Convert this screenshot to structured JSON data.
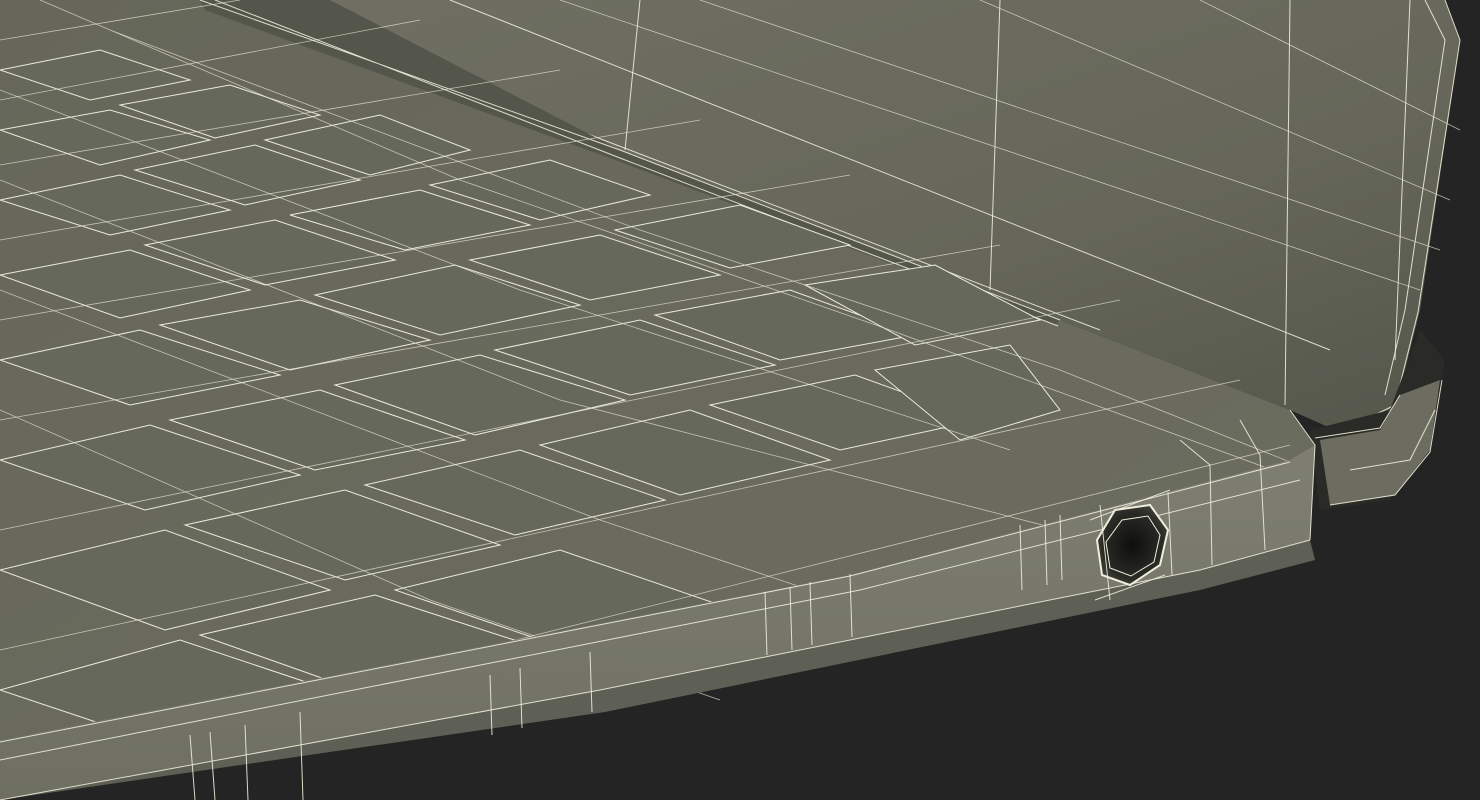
{
  "scene": {
    "subject": "laptop-wireframe-render",
    "palette": {
      "background": "#242424",
      "deck": "#6b6c5f",
      "deck_shadow": "#55564b",
      "edge": "#7a7b6e",
      "screen": "#6e6f62",
      "screen_shadow": "#4f5046",
      "wire": "#eeeddc",
      "port": "#1a1a1a"
    },
    "parts": [
      "keyboard-deck",
      "keys",
      "front-edge",
      "audio-port",
      "hinge",
      "screen-lid"
    ]
  }
}
